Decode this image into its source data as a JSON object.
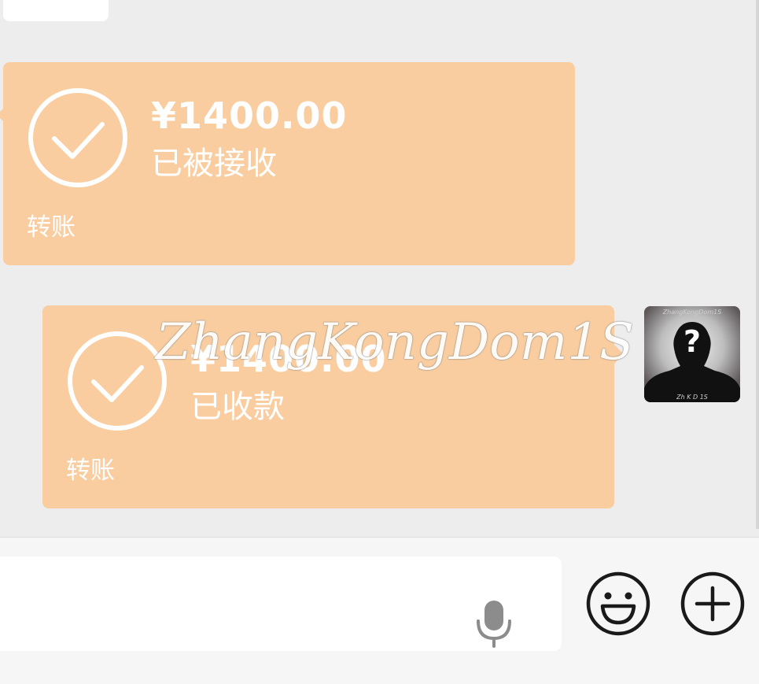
{
  "chat": {
    "messages": [
      {
        "side": "received",
        "amount": "¥1400.00",
        "status": "已被接收",
        "type_label": "转账"
      },
      {
        "side": "sent",
        "amount": "¥1400.00",
        "status": "已收款",
        "type_label": "转账"
      }
    ],
    "watermark": "ZhangKongDom1S",
    "avatar": {
      "question_mark": "?",
      "top_text": "ZhangKongDom1S",
      "bottom_text": "Zh  K  D  1S"
    }
  },
  "input_bar": {
    "mic_icon": "microphone-icon",
    "emoji_icon": "smiley-icon",
    "plus_icon": "plus-icon"
  },
  "colors": {
    "chat_background": "#ededed",
    "transfer_bubble": "#f9cd9f",
    "bubble_text": "#ffffff",
    "input_bar_background": "#f6f6f6",
    "icon_stroke": "#1a1a1a"
  }
}
